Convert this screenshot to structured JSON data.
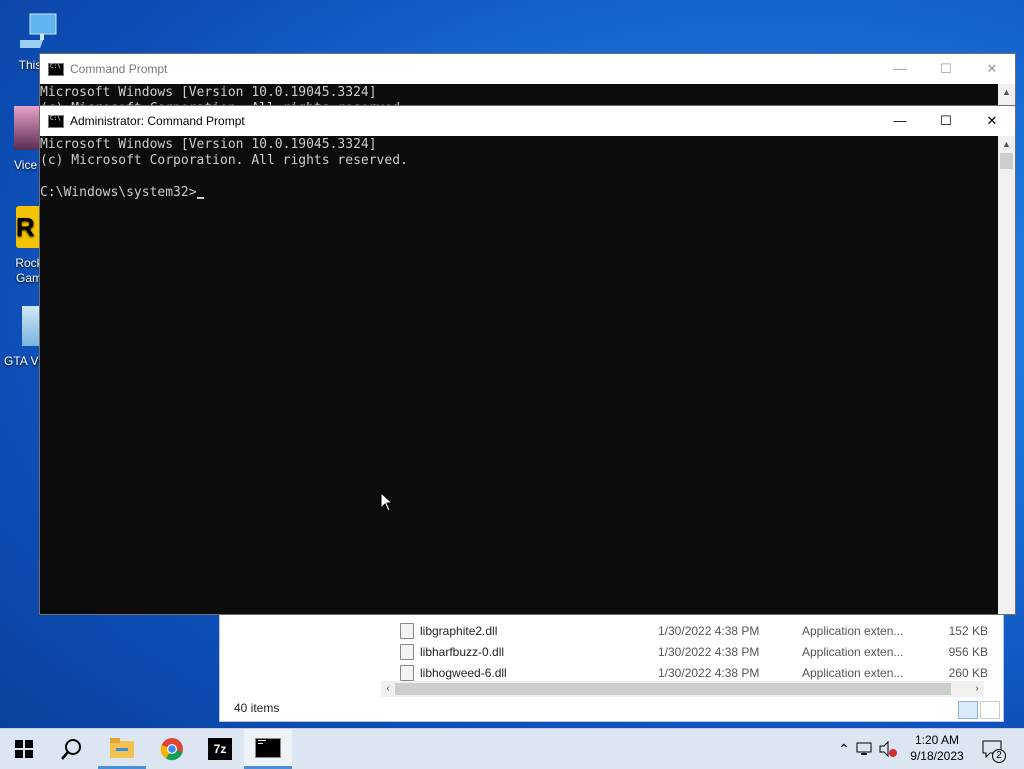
{
  "desktop": {
    "icons": [
      {
        "label": "This",
        "icon": "this-pc-icon"
      },
      {
        "label": "Vice",
        "icon": "vice-city-icon"
      },
      {
        "label": "Rock Gam",
        "icon": "rockstar-launcher-icon"
      },
      {
        "label": "GTA Vi",
        "icon": "gta-vice-city-icon"
      }
    ]
  },
  "explorer": {
    "rows": [
      {
        "name": "libgraphite2.dll",
        "date": "1/30/2022 4:38 PM",
        "type": "Application exten...",
        "size": "152 KB"
      },
      {
        "name": "libharfbuzz-0.dll",
        "date": "1/30/2022 4:38 PM",
        "type": "Application exten...",
        "size": "956 KB"
      },
      {
        "name": "libhogweed-6.dll",
        "date": "1/30/2022 4:38 PM",
        "type": "Application exten...",
        "size": "260 KB"
      }
    ],
    "status": "40 items"
  },
  "cmd_back": {
    "title": "Command Prompt",
    "line1": "Microsoft Windows [Version 10.0.19045.3324]",
    "line2": "(c) Microsoft Corporation. All rights reserved."
  },
  "cmd_front": {
    "title": "Administrator: Command Prompt",
    "line1": "Microsoft Windows [Version 10.0.19045.3324]",
    "line2": "(c) Microsoft Corporation. All rights reserved.",
    "prompt": "C:\\Windows\\system32>"
  },
  "window_controls": {
    "minimize": "—",
    "maximize": "☐",
    "close": "✕"
  },
  "taskbar": {
    "apps": [
      "start-icon",
      "search-icon",
      "file-explorer-icon",
      "chrome-icon",
      "7zip-icon",
      "command-prompt-icon"
    ],
    "sevenzip_label": "7z",
    "clock_time": "1:20 AM",
    "clock_date": "9/18/2023",
    "notification_count": "2"
  }
}
